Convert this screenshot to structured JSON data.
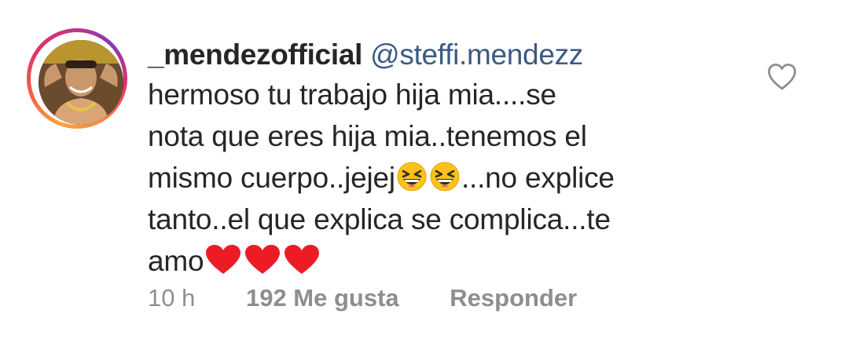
{
  "comment": {
    "username": "_mendezofficial",
    "mention": "@steffi.mendezz",
    "lines": [
      "hermoso tu trabajo hija mia....se",
      "nota que eres hija mia..tenemos el",
      "mismo cuerpo..jejej",
      "...no explice",
      "tanto..el que explica se complica...te",
      "amo"
    ],
    "emojis": {
      "laughing": "grinning-squinting-face",
      "heart": "red-heart"
    },
    "meta": {
      "time": "10 h",
      "likes": "192 Me gusta",
      "reply": "Responder"
    },
    "icons": {
      "like": "heart-outline-icon",
      "avatar_ring": "story-ring"
    },
    "colors": {
      "text": "#262626",
      "mention": "#3b5a83",
      "meta": "#8e8e8e",
      "heart": "#ed1c24"
    }
  }
}
